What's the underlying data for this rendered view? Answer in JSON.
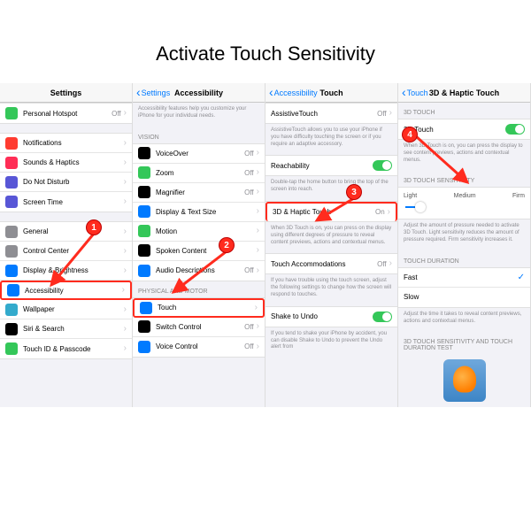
{
  "title": "Activate Touch Sensitivity",
  "panel1": {
    "nav_title": "Settings",
    "rows": [
      {
        "icon": "#34c759",
        "label": "Personal Hotspot",
        "value": "Off",
        "chev": true
      },
      {
        "gap": true
      },
      {
        "icon": "#ff3b30",
        "label": "Notifications",
        "chev": true
      },
      {
        "icon": "#ff2d55",
        "label": "Sounds & Haptics",
        "chev": true
      },
      {
        "icon": "#5856d6",
        "label": "Do Not Disturb",
        "chev": true
      },
      {
        "icon": "#5856d6",
        "label": "Screen Time",
        "chev": true
      },
      {
        "gap": true
      },
      {
        "icon": "#8e8e93",
        "label": "General",
        "chev": true
      },
      {
        "icon": "#8e8e93",
        "label": "Control Center",
        "chev": true
      },
      {
        "icon": "#007aff",
        "label": "Display & Brightness",
        "chev": true
      },
      {
        "icon": "#007aff",
        "label": "Accessibility",
        "chev": true,
        "highlight": true
      },
      {
        "icon": "#33aacc",
        "label": "Wallpaper",
        "chev": true
      },
      {
        "icon": "#000000",
        "label": "Siri & Search",
        "chev": true
      },
      {
        "icon": "#34c759",
        "label": "Touch ID & Passcode",
        "chev": true
      }
    ]
  },
  "panel2": {
    "back": "Settings",
    "nav_title": "Accessibility",
    "note": "Accessibility features help you customize your iPhone for your individual needs.",
    "section1": "VISION",
    "rows1": [
      {
        "icon": "#000",
        "label": "VoiceOver",
        "value": "Off",
        "chev": true
      },
      {
        "icon": "#34c759",
        "label": "Zoom",
        "value": "Off",
        "chev": true
      },
      {
        "icon": "#000",
        "label": "Magnifier",
        "value": "Off",
        "chev": true
      },
      {
        "icon": "#007aff",
        "label": "Display & Text Size",
        "chev": true
      },
      {
        "icon": "#34c759",
        "label": "Motion",
        "chev": true
      },
      {
        "icon": "#000",
        "label": "Spoken Content",
        "chev": true
      },
      {
        "icon": "#007aff",
        "label": "Audio Descriptions",
        "value": "Off",
        "chev": true
      }
    ],
    "section2": "PHYSICAL AND MOTOR",
    "rows2": [
      {
        "icon": "#007aff",
        "label": "Touch",
        "chev": true,
        "highlight": true
      },
      {
        "icon": "#000",
        "label": "Switch Control",
        "value": "Off",
        "chev": true
      },
      {
        "icon": "#007aff",
        "label": "Voice Control",
        "value": "Off",
        "chev": true
      }
    ]
  },
  "panel3": {
    "back": "Accessibility",
    "nav_title": "Touch",
    "rows": [
      {
        "label": "AssistiveTouch",
        "value": "Off",
        "chev": true
      },
      {
        "note": "AssistiveTouch allows you to use your iPhone if you have difficulty touching the screen or if you require an adaptive accessory."
      },
      {
        "label": "Reachability",
        "toggle": "on"
      },
      {
        "note": "Double-tap the home button to bring the top of the screen into reach."
      },
      {
        "label": "3D & Haptic Touch",
        "value": "On",
        "chev": true,
        "highlight": true
      },
      {
        "note": "When 3D Touch is on, you can press on the display using different degrees of pressure to reveal content previews, actions and contextual menus."
      },
      {
        "label": "Touch Accommodations",
        "value": "Off",
        "chev": true
      },
      {
        "note": "If you have trouble using the touch screen, adjust the following settings to change how the screen will respond to touches."
      },
      {
        "label": "Shake to Undo",
        "toggle": "on"
      },
      {
        "note": "If you tend to shake your iPhone by accident, you can disable Shake to Undo to prevent the Undo alert from"
      }
    ]
  },
  "panel4": {
    "back": "Touch",
    "nav_title": "3D & Haptic Touch",
    "section1": "3D TOUCH",
    "row1": {
      "label": "3D Touch",
      "toggle": "on"
    },
    "note1": "When 3D Touch is on, you can press the display to see content previews, actions and contextual menus.",
    "section2": "3D TOUCH SENSITIVITY",
    "slider": {
      "left": "Light",
      "mid": "Medium",
      "right": "Firm"
    },
    "note2": "Adjust the amount of pressure needed to activate 3D Touch. Light sensitivity reduces the amount of pressure required. Firm sensitivity increases it.",
    "section3": "TOUCH DURATION",
    "rows3": [
      {
        "label": "Fast",
        "check": true
      },
      {
        "label": "Slow"
      }
    ],
    "note3": "Adjust the time it takes to reveal content previews, actions and contextual menus.",
    "section4": "3D TOUCH SENSITIVITY AND TOUCH DURATION TEST"
  },
  "callouts": {
    "1": "1",
    "2": "2",
    "3": "3",
    "4": "4"
  }
}
